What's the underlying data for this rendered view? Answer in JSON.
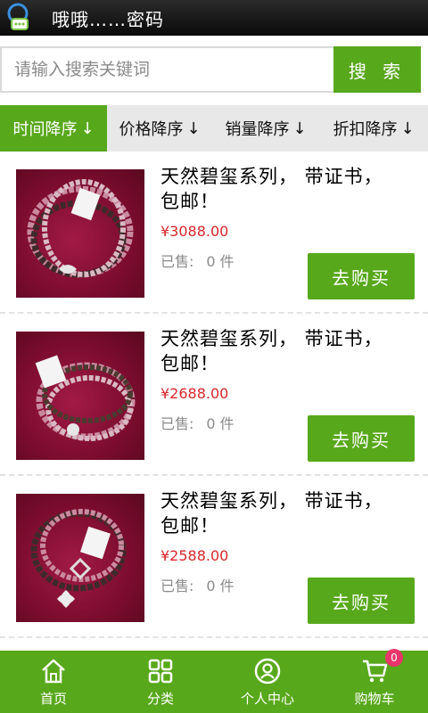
{
  "app": {
    "title": "哦哦……密码",
    "icon": "chat-bubble-icon"
  },
  "search": {
    "placeholder": "请输入搜索关键词",
    "button_label": "搜 索"
  },
  "sort_tabs": [
    {
      "label": "时间降序",
      "arrow": "↓",
      "active": true
    },
    {
      "label": "价格降序",
      "arrow": "↓",
      "active": false
    },
    {
      "label": "销量降序",
      "arrow": "↓",
      "active": false
    },
    {
      "label": "折扣降序",
      "arrow": "↓",
      "active": false
    }
  ],
  "products": [
    {
      "name": "天然碧玺系列， 带证书，包邮！",
      "price": "¥3088.00",
      "sold_label": "已售:",
      "sold_value": "0 件",
      "button_label": "去购买"
    },
    {
      "name": "天然碧玺系列， 带证书，包邮！",
      "price": "¥2688.00",
      "sold_label": "已售:",
      "sold_value": "0 件",
      "button_label": "去购买"
    },
    {
      "name": "天然碧玺系列， 带证书，包邮！",
      "price": "¥2588.00",
      "sold_label": "已售:",
      "sold_value": "0 件",
      "button_label": "去购买"
    }
  ],
  "bottom_nav": [
    {
      "label": "首页",
      "icon": "home-icon"
    },
    {
      "label": "分类",
      "icon": "grid-icon"
    },
    {
      "label": "个人中心",
      "icon": "user-center-icon"
    },
    {
      "label": "购物车",
      "icon": "cart-icon",
      "badge": "0"
    }
  ],
  "colors": {
    "accent": "#58a81b",
    "price": "#d7262c",
    "badge": "#e8356b"
  }
}
